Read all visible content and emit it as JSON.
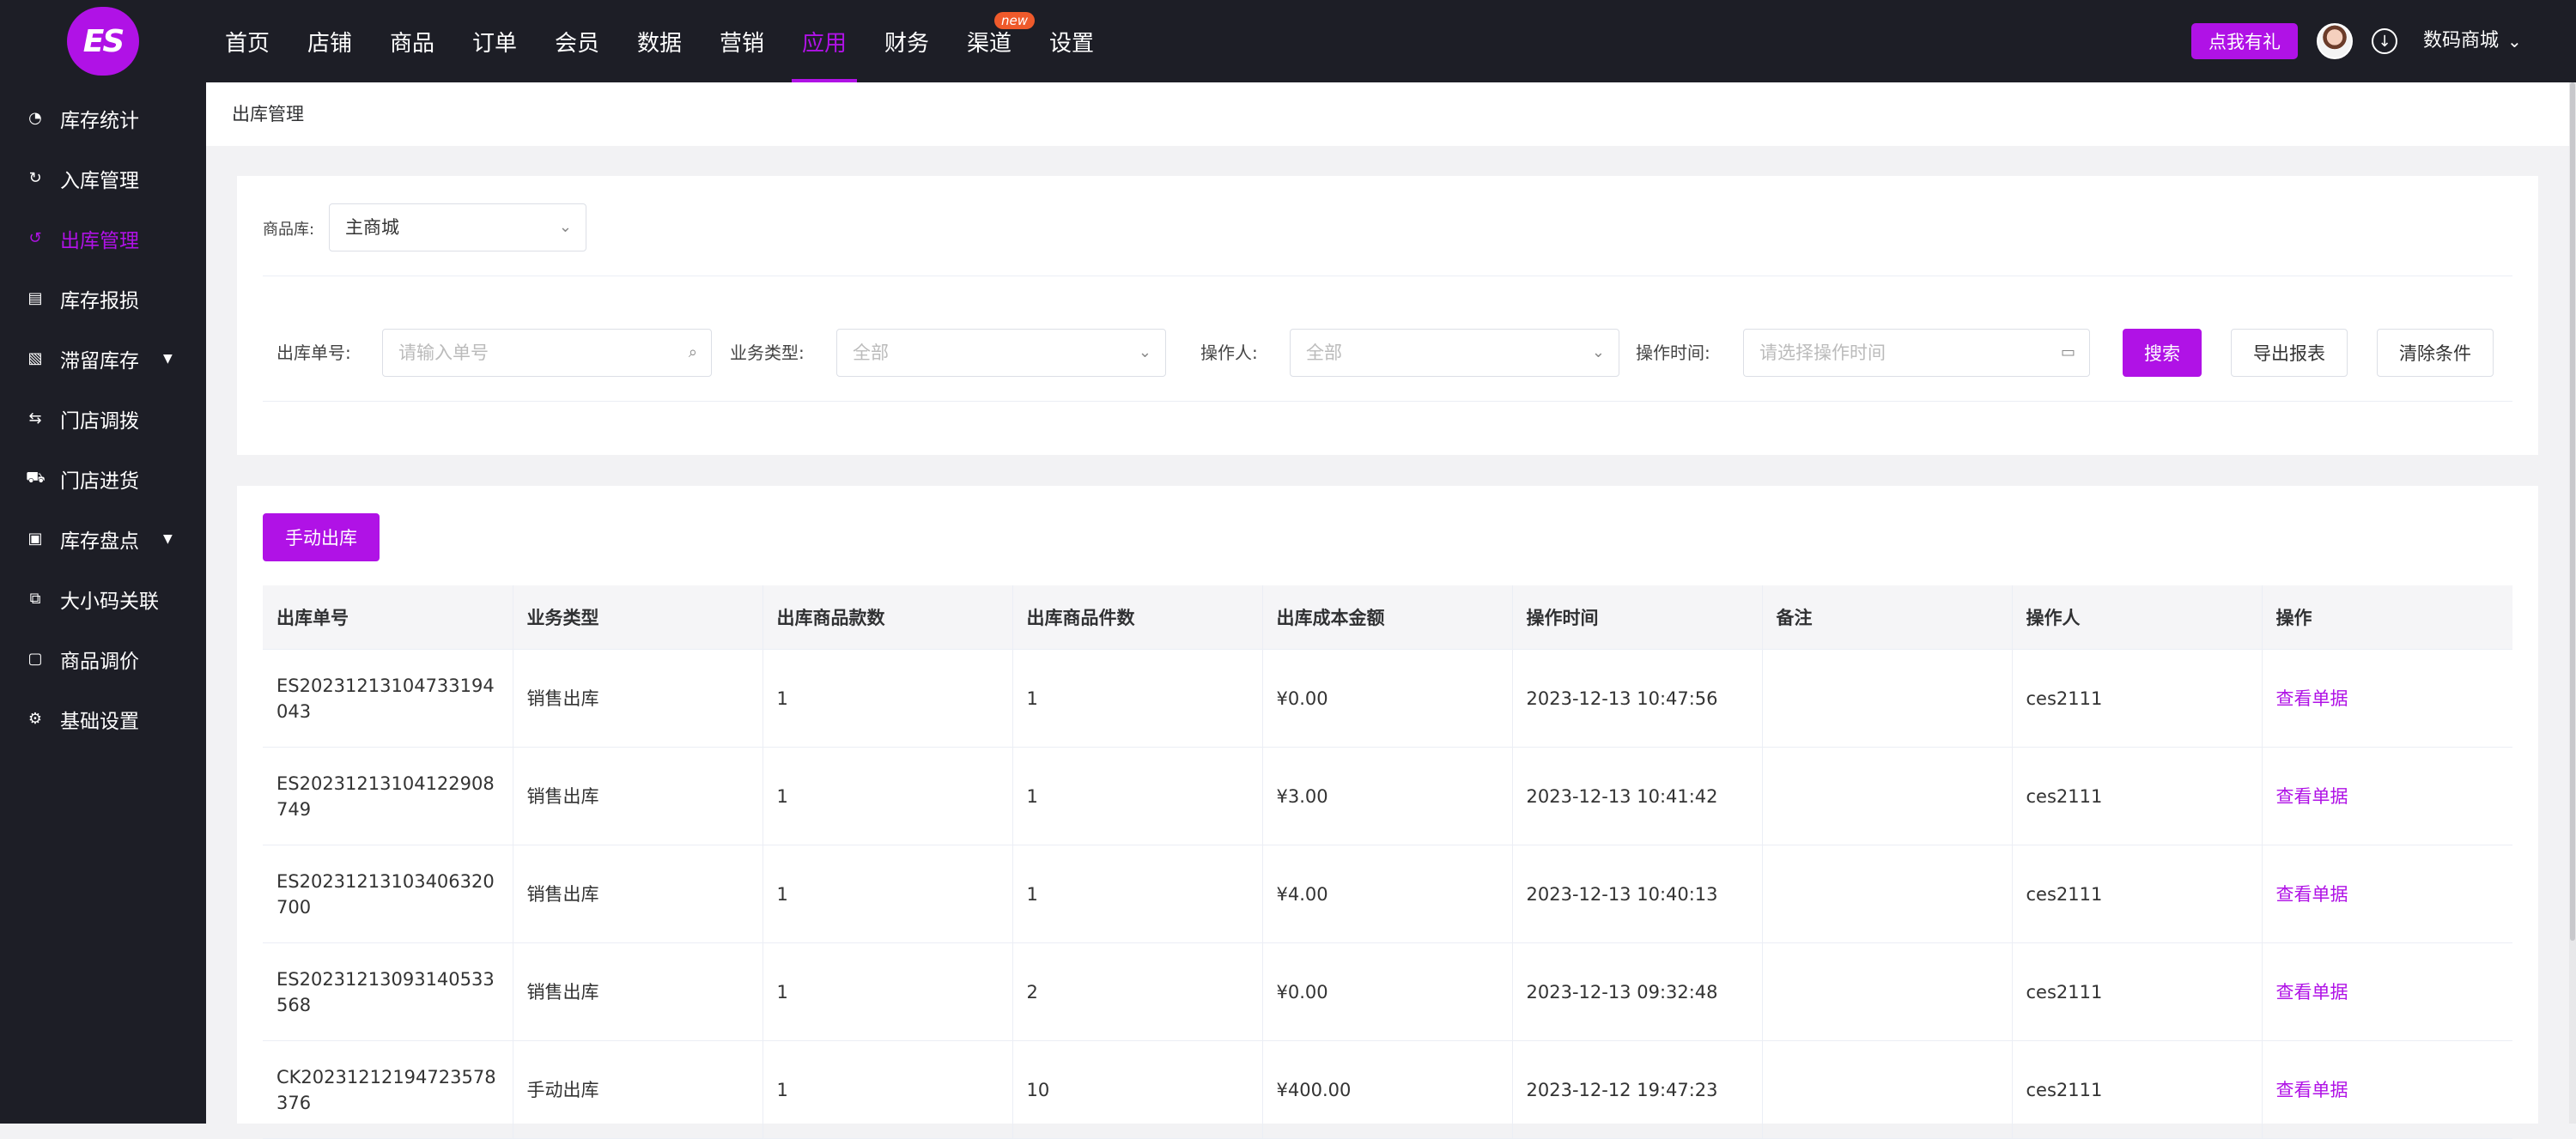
{
  "brand": {
    "logo_text": "ES",
    "accent": "#b012e6",
    "dark_bg": "#1d1e26"
  },
  "topnav": [
    {
      "label": "首页"
    },
    {
      "label": "店铺"
    },
    {
      "label": "商品"
    },
    {
      "label": "订单"
    },
    {
      "label": "会员"
    },
    {
      "label": "数据"
    },
    {
      "label": "营销"
    },
    {
      "label": "应用",
      "active": true
    },
    {
      "label": "财务"
    },
    {
      "label": "渠道",
      "badge": "new"
    },
    {
      "label": "设置"
    }
  ],
  "header": {
    "gift_label": "点我有礼",
    "username": "数码商城",
    "avatar_icon": "user-avatar",
    "download_icon": "download-icon"
  },
  "sidebar": [
    {
      "label": "库存统计",
      "icon": "pie-chart-icon"
    },
    {
      "label": "入库管理",
      "icon": "inbound-icon"
    },
    {
      "label": "出库管理",
      "icon": "outbound-icon",
      "active": true
    },
    {
      "label": "库存报损",
      "icon": "report-icon"
    },
    {
      "label": "滞留库存",
      "icon": "stock-icon",
      "expandable": true
    },
    {
      "label": "门店调拨",
      "icon": "transfer-icon"
    },
    {
      "label": "门店进货",
      "icon": "cart-icon"
    },
    {
      "label": "库存盘点",
      "icon": "inventory-icon",
      "expandable": true
    },
    {
      "label": "大小码关联",
      "icon": "link-icon"
    },
    {
      "label": "商品调价",
      "icon": "price-icon"
    },
    {
      "label": "基础设置",
      "icon": "settings-icon"
    }
  ],
  "breadcrumb": "出库管理",
  "filters": {
    "store_label": "商品库:",
    "store_value": "主商城",
    "order_no_label": "出库单号:",
    "order_no_placeholder": "请输入单号",
    "biz_type_label": "业务类型:",
    "biz_type_value": "全部",
    "operator_label": "操作人:",
    "operator_value": "全部",
    "time_label": "操作时间:",
    "time_placeholder": "请选择操作时间",
    "search_btn": "搜索",
    "export_btn": "导出报表",
    "clear_btn": "清除条件"
  },
  "manual_btn": "手动出库",
  "table": {
    "columns": [
      "出库单号",
      "业务类型",
      "出库商品款数",
      "出库商品件数",
      "出库成本金额",
      "操作时间",
      "备注",
      "操作人",
      "操作"
    ],
    "rows": [
      {
        "no": "ES20231213104733194043",
        "type": "销售出库",
        "styles": "1",
        "pieces": "1",
        "cost": "¥0.00",
        "time": "2023-12-13 10:47:56",
        "remark": "",
        "operator": "ces2111",
        "action": "查看单据"
      },
      {
        "no": "ES20231213104122908749",
        "type": "销售出库",
        "styles": "1",
        "pieces": "1",
        "cost": "¥3.00",
        "time": "2023-12-13 10:41:42",
        "remark": "",
        "operator": "ces2111",
        "action": "查看单据"
      },
      {
        "no": "ES20231213103406320700",
        "type": "销售出库",
        "styles": "1",
        "pieces": "1",
        "cost": "¥4.00",
        "time": "2023-12-13 10:40:13",
        "remark": "",
        "operator": "ces2111",
        "action": "查看单据"
      },
      {
        "no": "ES20231213093140533568",
        "type": "销售出库",
        "styles": "1",
        "pieces": "2",
        "cost": "¥0.00",
        "time": "2023-12-13 09:32:48",
        "remark": "",
        "operator": "ces2111",
        "action": "查看单据"
      },
      {
        "no": "CK20231212194723578376",
        "type": "手动出库",
        "styles": "1",
        "pieces": "10",
        "cost": "¥400.00",
        "time": "2023-12-12 19:47:23",
        "remark": "",
        "operator": "ces2111",
        "action": "查看单据"
      }
    ]
  }
}
